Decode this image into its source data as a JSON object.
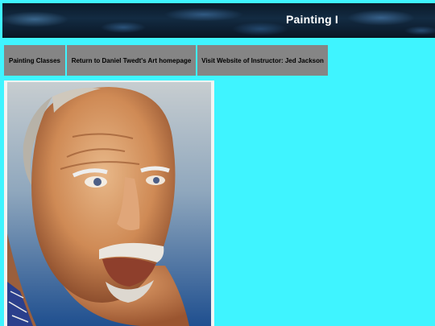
{
  "banner": {
    "title": "Painting I"
  },
  "nav": {
    "items": [
      {
        "label": "Painting Classes"
      },
      {
        "label": "Return to Daniel Twedt's Art homepage"
      },
      {
        "label": "Visit Website of Instructor: Jed Jackson"
      }
    ]
  },
  "colors": {
    "page_background": "#3ff4ff",
    "nav_button": "#858585",
    "banner_text": "#ffffff"
  }
}
